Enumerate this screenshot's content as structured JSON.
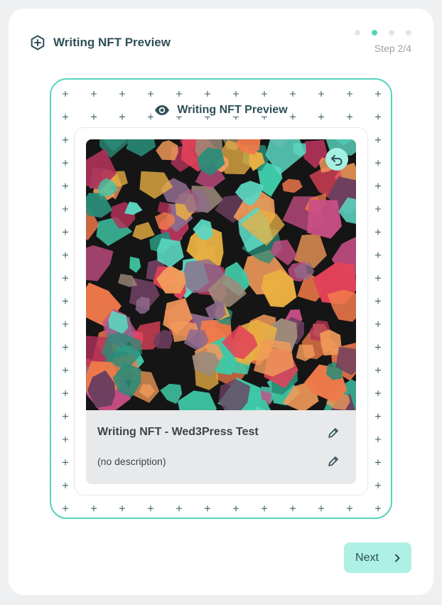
{
  "header": {
    "title": "Writing NFT Preview",
    "icon": "plus-circle-icon"
  },
  "steps": {
    "label": "Step 2/4",
    "current": 2,
    "total": 4
  },
  "preview": {
    "title": "Writing NFT Preview",
    "title_icon": "eye-icon",
    "nft": {
      "name": "Writing NFT - Wed3Press Test",
      "description": "(no description)",
      "flip_icon": "undo-icon",
      "edit_icon": "pencil-icon"
    }
  },
  "footer": {
    "next_label": "Next",
    "next_icon": "chevron-right-icon"
  },
  "colors": {
    "accent": "#56d4bd",
    "accent_light": "#aef0e4",
    "text": "#2f4f57"
  }
}
